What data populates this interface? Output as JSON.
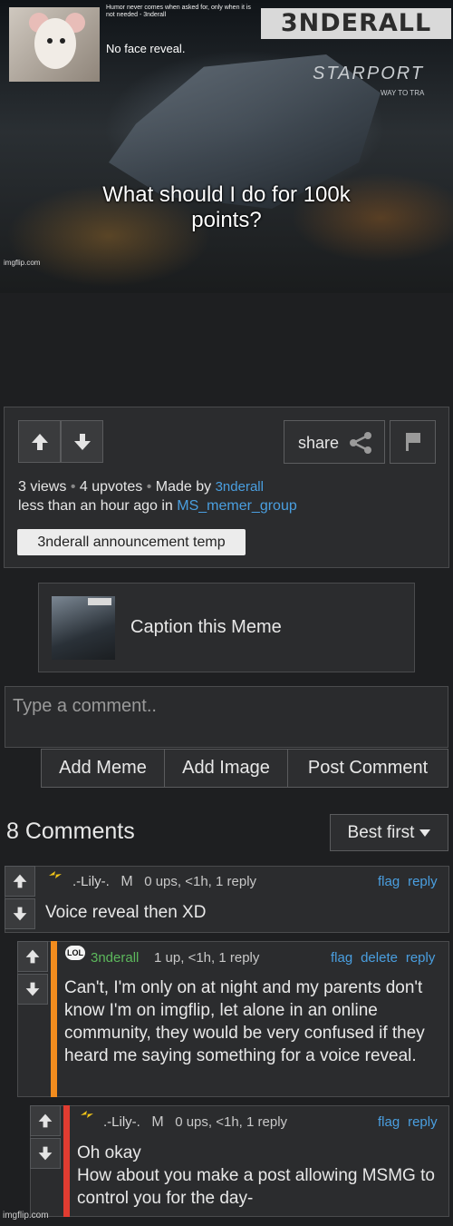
{
  "meme": {
    "template_quote": "Humor never comes when asked for, only when it is not needed - 3nderall",
    "brand": "3NDERALL",
    "no_face": "No face reveal.",
    "starport": "STARPORT",
    "way_to": "WAY TO TRA",
    "caption": "What should I do for 100k points?",
    "watermark": "imgflip.com"
  },
  "post": {
    "share_label": "share",
    "views": "3 views",
    "upvotes": "4 upvotes",
    "made_by_prefix": "Made by",
    "author": "3nderall",
    "time_prefix": "less than an hour ago in",
    "stream": "MS_memer_group",
    "template_tag": "3nderall announcement temp",
    "caption_meme": "Caption this Meme"
  },
  "comment_form": {
    "placeholder": "Type a comment..",
    "add_meme": "Add Meme",
    "add_image": "Add Image",
    "post_comment": "Post Comment"
  },
  "comments_header": {
    "count": "8 Comments",
    "sort": "Best first"
  },
  "comments": [
    {
      "user": ".-Lily-.",
      "badge": "M",
      "stats": "0 ups, <1h, 1 reply",
      "flag": "flag",
      "reply": "reply",
      "text": "Voice reveal then XD"
    },
    {
      "user": "3nderall",
      "badge_icon": "LOL",
      "stats": "1 up, <1h, 1 reply",
      "flag": "flag",
      "delete": "delete",
      "reply": "reply",
      "text": "Can't, I'm only on at night and my parents don't know I'm on imgflip, let alone in an online community, they would be very confused if they heard me saying something for a voice reveal."
    },
    {
      "user": ".-Lily-.",
      "badge": "M",
      "stats": "0 ups, <1h, 1 reply",
      "flag": "flag",
      "reply": "reply",
      "text_line1": "Oh okay",
      "text_line2": "How about you make a post allowing MSMG to control you for the day-"
    }
  ],
  "footer_watermark": "imgflip.com",
  "colors": {
    "link": "#4a9fe0",
    "orange_bar": "#f28c1e",
    "red_bar": "#e03c31",
    "green_user": "#5cb85c"
  }
}
